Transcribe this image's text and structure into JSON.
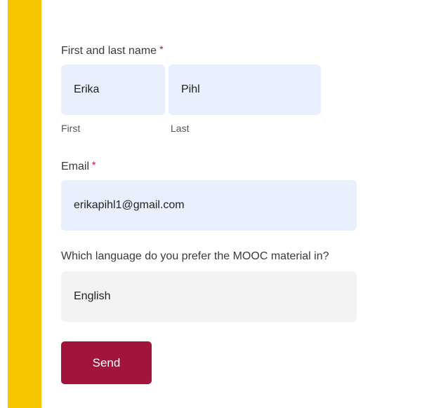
{
  "form": {
    "name_label": "First and last name",
    "required_mark": "*",
    "first_name_value": "Erika",
    "last_name_value": "Pihl",
    "first_sublabel": "First",
    "last_sublabel": "Last",
    "email_label": "Email",
    "email_value": "erikapihl1@gmail.com",
    "language_label": "Which language do you prefer the MOOC material in?",
    "language_value": "English",
    "send_label": "Send"
  },
  "colors": {
    "accent_bar": "#f6c600",
    "input_background": "#e8f0fe",
    "select_background": "#f3f3f3",
    "required_mark": "#c8102e",
    "send_button": "#a3143b"
  }
}
